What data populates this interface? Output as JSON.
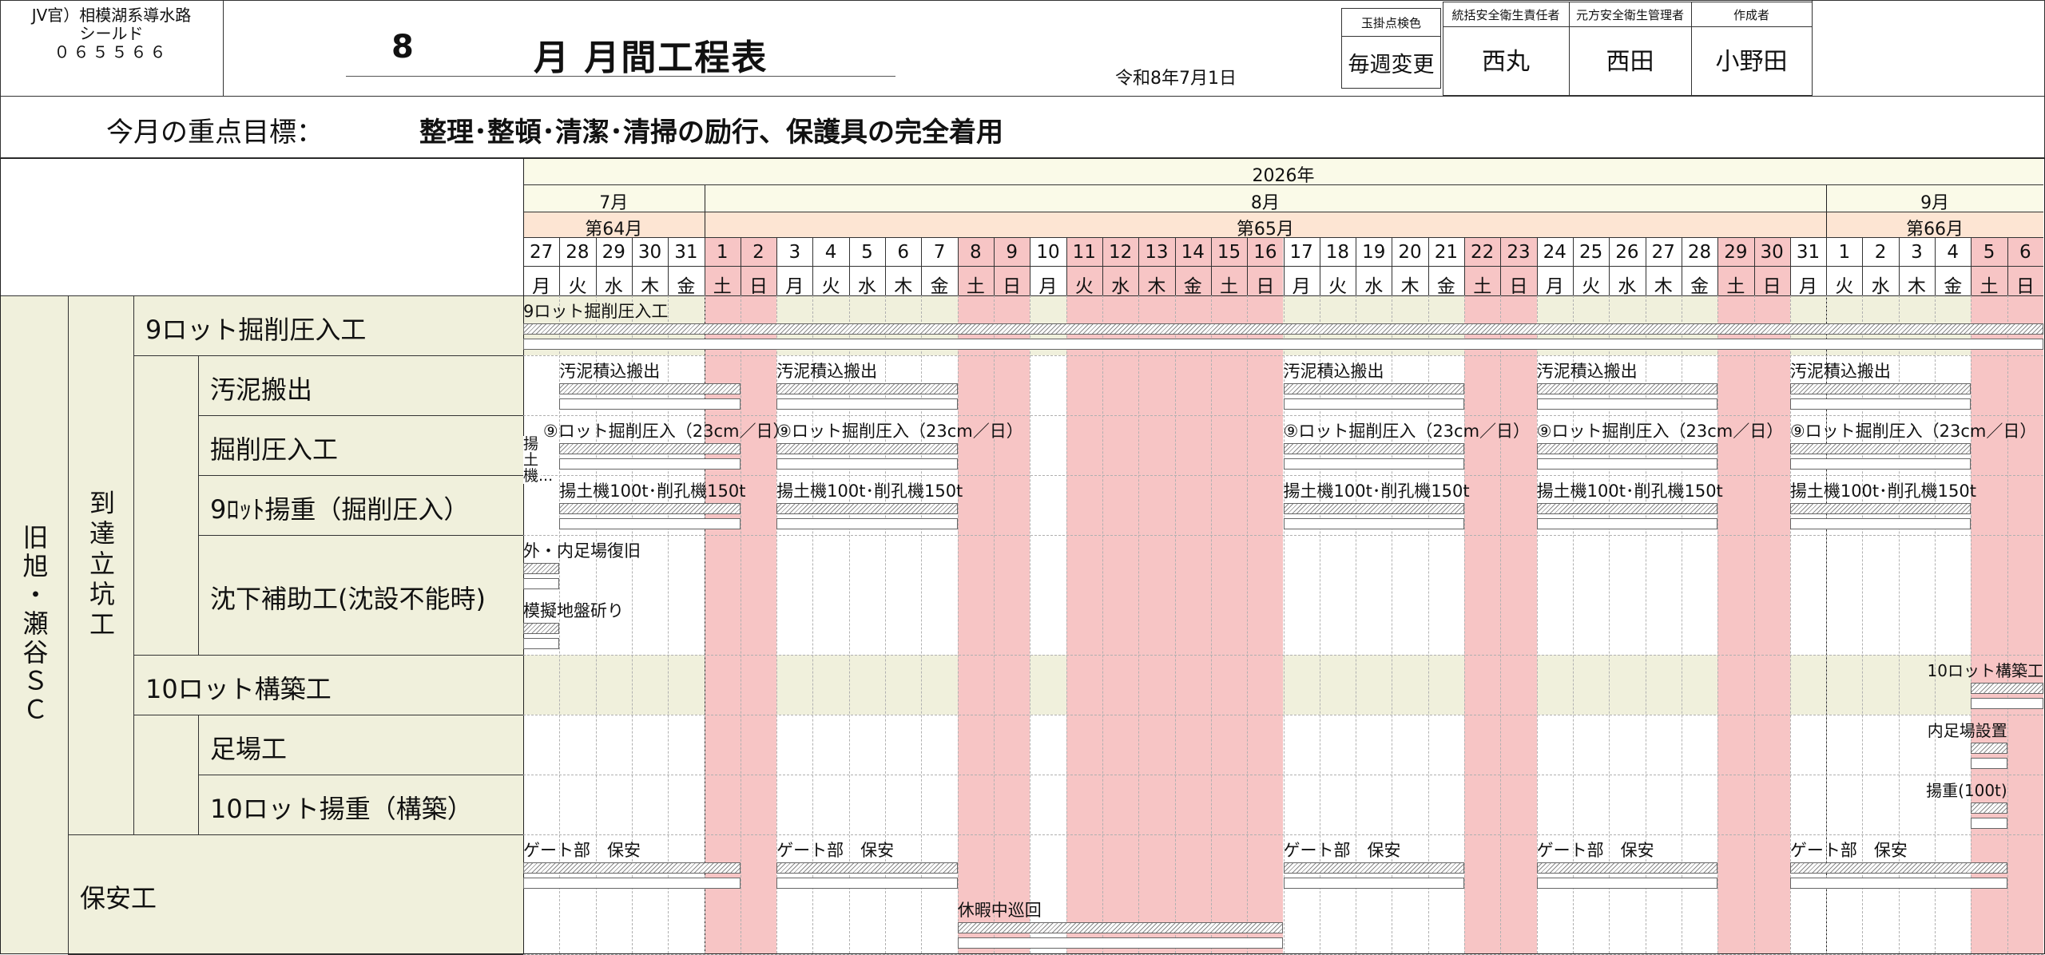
{
  "header": {
    "project_lines": [
      "JV官）相模湖系導水路",
      "シールド",
      "０６５５６６"
    ],
    "month": "8",
    "title_suffix": "月 月間工程表",
    "date": "令和8年7月1日",
    "inspection_color_label": "玉掛点検色",
    "inspection_color_value": "毎週変更",
    "roles": [
      {
        "label": "統括安全衛生責任者",
        "name": "西丸"
      },
      {
        "label": "元方安全衛生管理者",
        "name": "西田"
      },
      {
        "label": "作成者",
        "name": "小野田"
      }
    ]
  },
  "goal": {
    "label": "今月の重点目標：",
    "text": "整理･整頓･清潔･清掃の励行、保護具の完全着用"
  },
  "calendar": {
    "year": "2026年",
    "months": [
      {
        "label": "7月",
        "first_day": 0,
        "day_count": 5
      },
      {
        "label": "8月",
        "first_day": 5,
        "day_count": 31
      },
      {
        "label": "9月",
        "first_day": 36,
        "day_count": 6
      }
    ],
    "weeks": [
      {
        "label": "第64月",
        "first_day": 0,
        "day_count": 5
      },
      {
        "label": "第65月",
        "first_day": 5,
        "day_count": 31
      },
      {
        "label": "第66月",
        "first_day": 36,
        "day_count": 6
      }
    ],
    "days": [
      {
        "d": "27",
        "w": "月"
      },
      {
        "d": "28",
        "w": "火"
      },
      {
        "d": "29",
        "w": "水"
      },
      {
        "d": "30",
        "w": "木"
      },
      {
        "d": "31",
        "w": "金"
      },
      {
        "d": "1",
        "w": "土",
        "h": true
      },
      {
        "d": "2",
        "w": "日",
        "h": true
      },
      {
        "d": "3",
        "w": "月"
      },
      {
        "d": "4",
        "w": "火"
      },
      {
        "d": "5",
        "w": "水"
      },
      {
        "d": "6",
        "w": "木"
      },
      {
        "d": "7",
        "w": "金"
      },
      {
        "d": "8",
        "w": "土",
        "h": true
      },
      {
        "d": "9",
        "w": "日",
        "h": true
      },
      {
        "d": "10",
        "w": "月"
      },
      {
        "d": "11",
        "w": "火",
        "h": true
      },
      {
        "d": "12",
        "w": "水",
        "h": true
      },
      {
        "d": "13",
        "w": "木",
        "h": true
      },
      {
        "d": "14",
        "w": "金",
        "h": true
      },
      {
        "d": "15",
        "w": "土",
        "h": true
      },
      {
        "d": "16",
        "w": "日",
        "h": true
      },
      {
        "d": "17",
        "w": "月"
      },
      {
        "d": "18",
        "w": "火"
      },
      {
        "d": "19",
        "w": "水"
      },
      {
        "d": "20",
        "w": "木"
      },
      {
        "d": "21",
        "w": "金"
      },
      {
        "d": "22",
        "w": "土",
        "h": true
      },
      {
        "d": "23",
        "w": "日",
        "h": true
      },
      {
        "d": "24",
        "w": "月"
      },
      {
        "d": "25",
        "w": "火"
      },
      {
        "d": "26",
        "w": "水"
      },
      {
        "d": "27",
        "w": "木"
      },
      {
        "d": "28",
        "w": "金"
      },
      {
        "d": "29",
        "w": "土",
        "h": true
      },
      {
        "d": "30",
        "w": "日",
        "h": true
      },
      {
        "d": "31",
        "w": "月"
      },
      {
        "d": "1",
        "w": "火"
      },
      {
        "d": "2",
        "w": "水"
      },
      {
        "d": "3",
        "w": "木"
      },
      {
        "d": "4",
        "w": "金"
      },
      {
        "d": "5",
        "w": "土",
        "h": true
      },
      {
        "d": "6",
        "w": "日",
        "h": true
      }
    ]
  },
  "site": {
    "label": "旧旭・瀬谷ＳＣ"
  },
  "shaft": {
    "label": "到達立坑工"
  },
  "rows": [
    {
      "label": "9ロット掘削圧入工",
      "level": 1,
      "band": true,
      "tasks": [
        {
          "label": "9ロット掘削圧入工",
          "start": 0,
          "end": 42,
          "full": true
        }
      ]
    },
    {
      "label": "汚泥搬出",
      "level": 2,
      "tasks": [
        {
          "label": "汚泥積込搬出",
          "start": 1,
          "end": 6
        },
        {
          "label": "汚泥積込搬出",
          "start": 7,
          "end": 12
        },
        {
          "label": "汚泥積込搬出",
          "start": 21,
          "end": 26
        },
        {
          "label": "汚泥積込搬出",
          "start": 28,
          "end": 33
        },
        {
          "label": "汚泥積込搬出",
          "start": 35,
          "end": 40
        }
      ]
    },
    {
      "label": "掘削圧入工",
      "level": 2,
      "tasks": [
        {
          "label": "⑨ロット掘削圧入（23cm／日）",
          "start": 1,
          "end": 6,
          "label_from": 0.55
        },
        {
          "label": "⑨ロット掘削圧入（23cm／日）",
          "start": 7,
          "end": 12
        },
        {
          "label": "⑨ロット掘削圧入（23cm／日）",
          "start": 21,
          "end": 26
        },
        {
          "label": "⑨ロット掘削圧入（23cm／日）",
          "start": 28,
          "end": 33
        },
        {
          "label": "⑨ロット掘削圧入（23cm／日）",
          "start": 35,
          "end": 40
        }
      ]
    },
    {
      "label": "9ﾛｯﾄ揚重（掘削圧入）",
      "level": 2,
      "tasks": [
        {
          "label": "揚土機100t･削孔機150t",
          "start": 1,
          "end": 6
        },
        {
          "label": "揚土機100t･削孔機150t",
          "start": 7,
          "end": 12
        },
        {
          "label": "揚土機100t･削孔機150t",
          "start": 21,
          "end": 26
        },
        {
          "label": "揚土機100t･削孔機150t",
          "start": 28,
          "end": 33
        },
        {
          "label": "揚土機100t･削孔機150t",
          "start": 35,
          "end": 40
        }
      ]
    },
    {
      "label": "沈下補助工(沈設不能時)",
      "level": 2,
      "tall": true,
      "tasks": [
        {
          "label": "外・内足場復旧",
          "start": 0,
          "end": 1,
          "slot": 0
        },
        {
          "label": "模擬地盤斫り",
          "start": 0,
          "end": 1,
          "slot": 1
        }
      ]
    },
    {
      "label": "10ロット構築工",
      "level": 1,
      "band": true,
      "tasks": [
        {
          "label": "10ロット構築工",
          "start": 40,
          "end": 42,
          "align": "right"
        }
      ]
    },
    {
      "label": "足場工",
      "level": 2,
      "tasks": [
        {
          "label": "内足場設置",
          "start": 40,
          "end": 41,
          "align": "right"
        }
      ]
    },
    {
      "label": "10ロット揚重（構築）",
      "level": 2,
      "tasks": [
        {
          "label": "揚重(100t)",
          "start": 40,
          "end": 41,
          "align": "right"
        }
      ]
    },
    {
      "label": "保安工",
      "level": 0,
      "tall": true,
      "tasks": [
        {
          "label": "ゲート部　保安",
          "start": 0,
          "end": 6
        },
        {
          "label": "ゲート部　保安",
          "start": 7,
          "end": 12
        },
        {
          "label": "ゲート部　保安",
          "start": 21,
          "end": 26
        },
        {
          "label": "ゲート部　保安",
          "start": 28,
          "end": 33
        },
        {
          "label": "ゲート部　保安",
          "start": 35,
          "end": 41
        },
        {
          "label": "休暇中巡回",
          "start": 12,
          "end": 21,
          "slot": 1
        }
      ]
    }
  ],
  "side_note": {
    "label": "揚土機..."
  },
  "colors": {
    "holiday": "#f7c5c5",
    "year_band": "#fafae8",
    "week_band": "#fde5d3",
    "label_bg": "#f0f0dc",
    "row_band": "#f0f0dc",
    "hatch": "#888888"
  }
}
